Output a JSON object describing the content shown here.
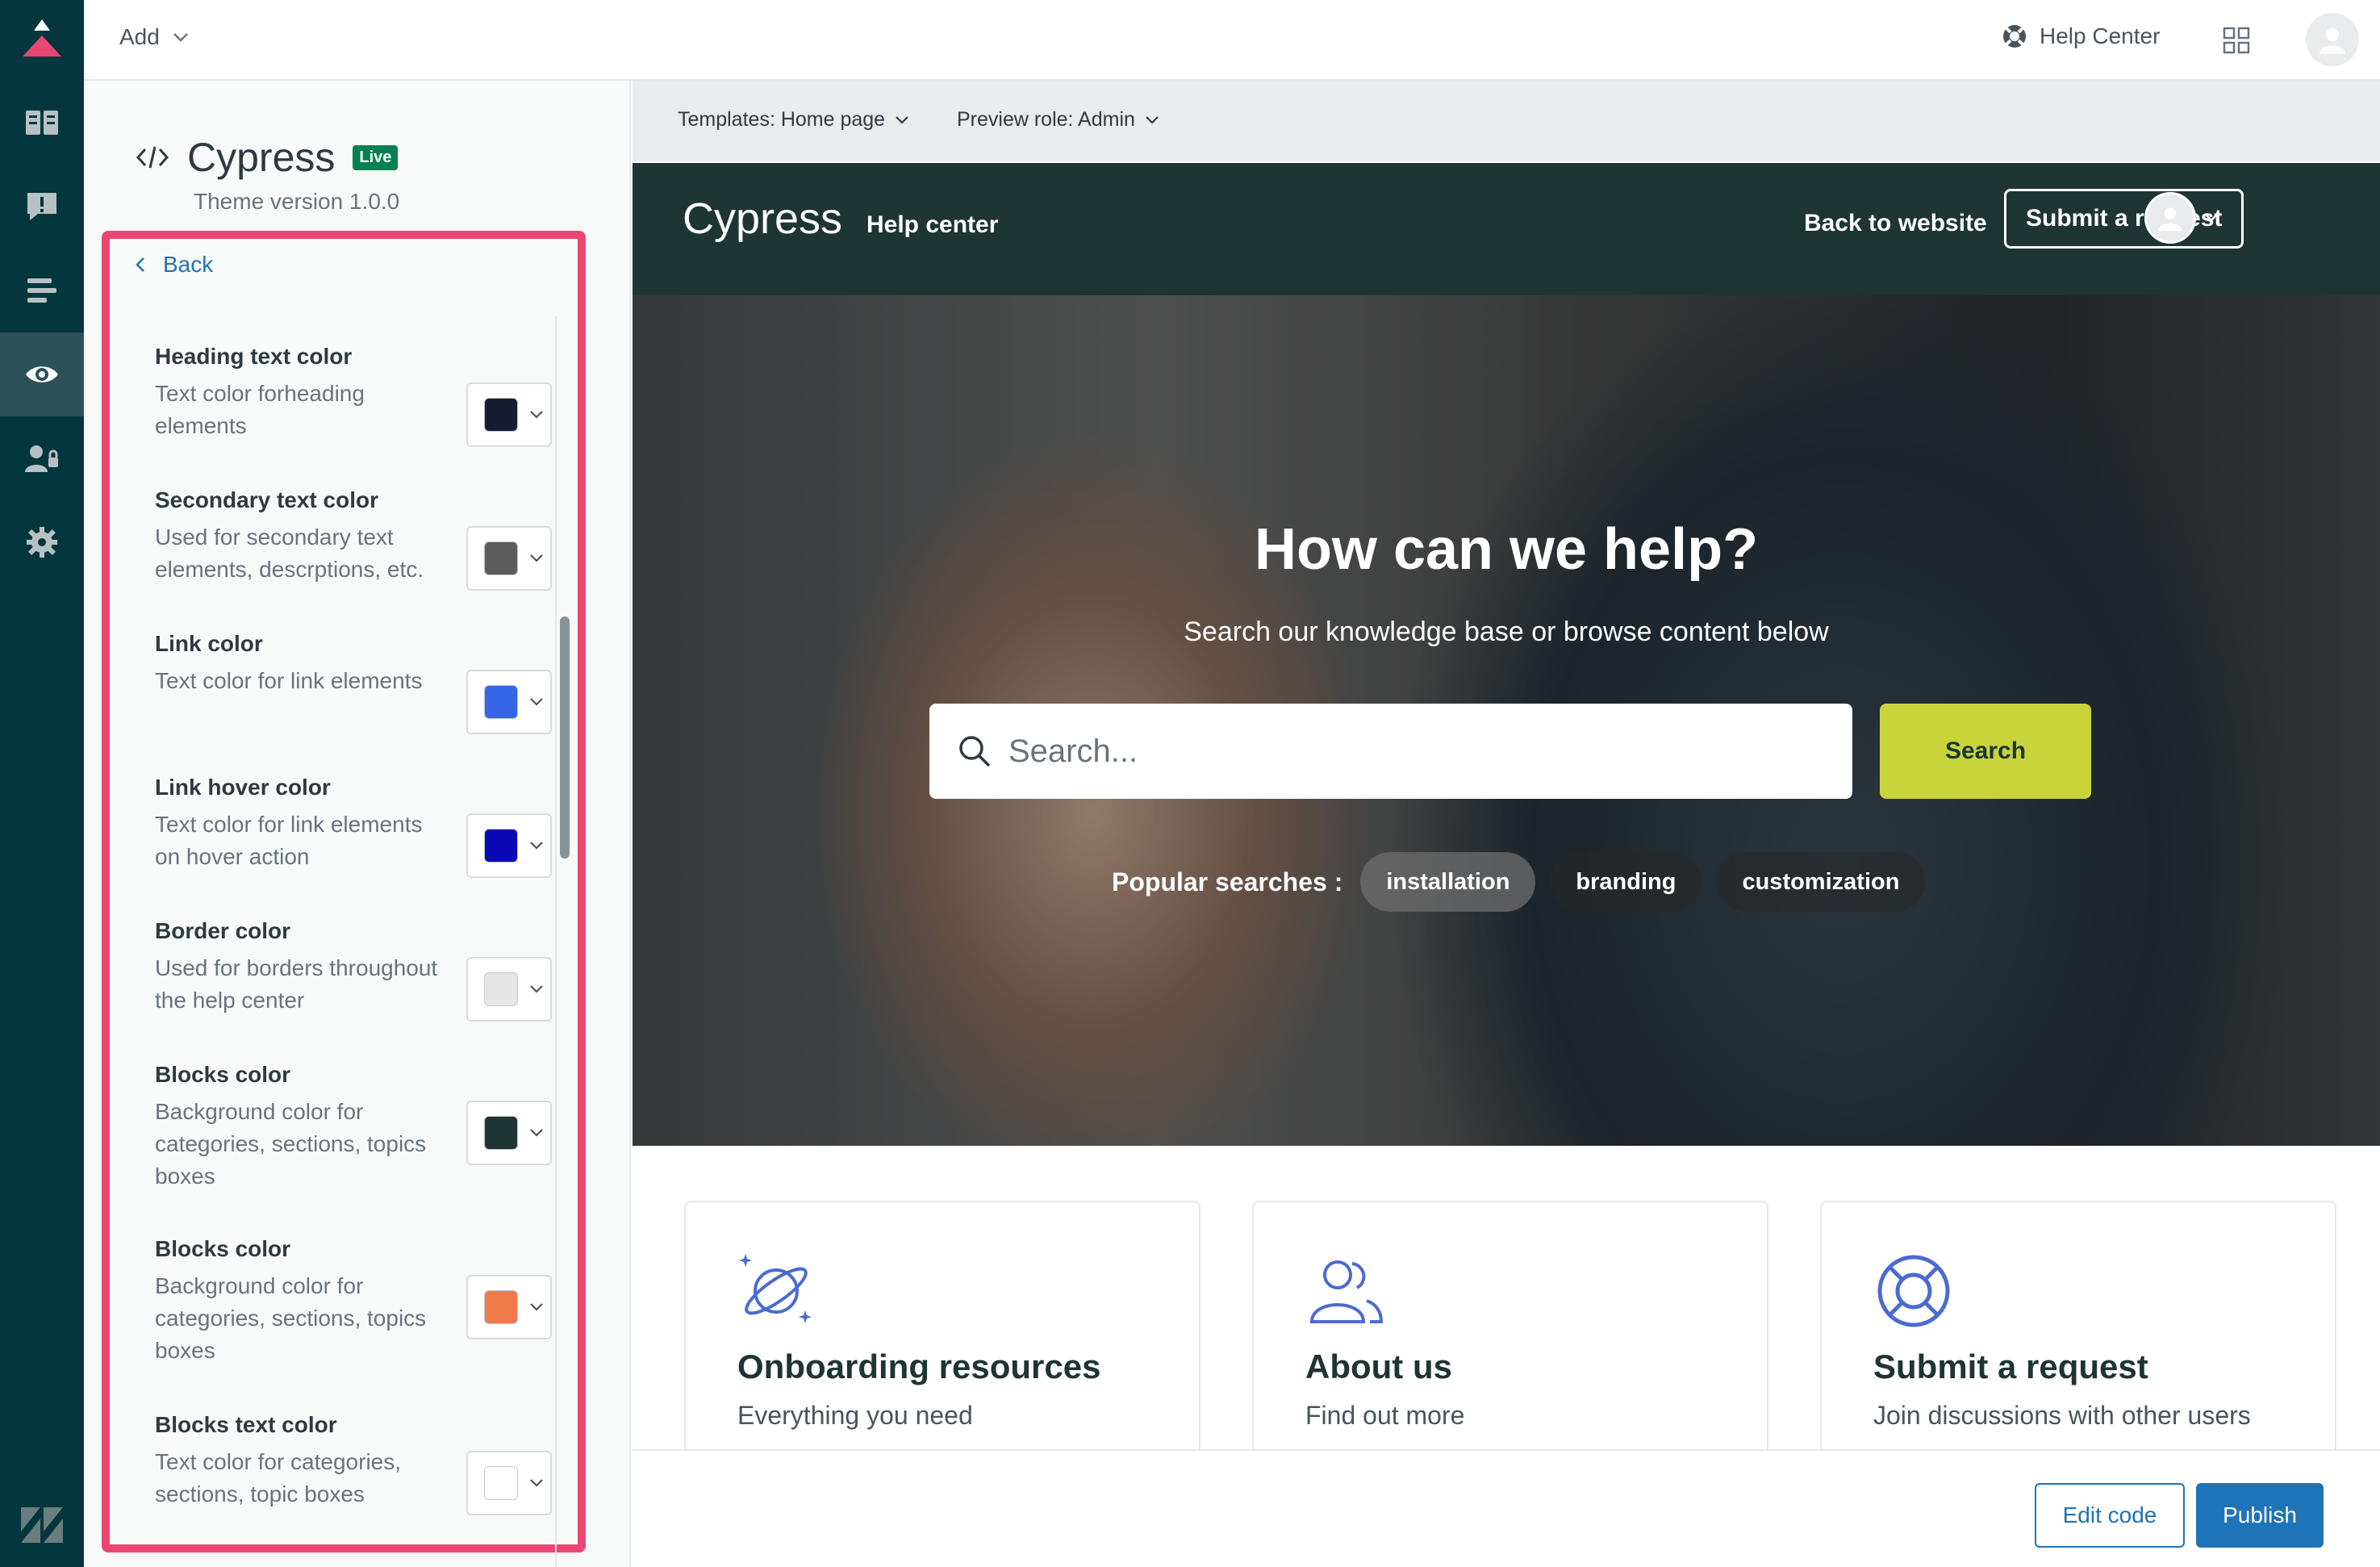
{
  "topbar": {
    "add_label": "Add",
    "help_center_label": "Help Center"
  },
  "rail": {
    "icons": [
      "zendesk-up-icon",
      "knowledge-icon",
      "alert-icon",
      "layout-icon",
      "eye-icon",
      "user-lock-icon",
      "gear-icon",
      "zendesk-logo-icon"
    ]
  },
  "panel": {
    "theme_name": "Cypress",
    "live_badge": "Live",
    "theme_version": "Theme version 1.0.0",
    "back_label": "Back",
    "settings": [
      {
        "title": "Heading text color",
        "description": "Text color forheading elements",
        "color": "#171c33"
      },
      {
        "title": "Secondary text color",
        "description": "Used for secondary text elements, descrptions, etc.",
        "color": "#5c5c5c"
      },
      {
        "title": "Link color",
        "description": "Text color for link elements",
        "color": "#3566e8"
      },
      {
        "title": "Link hover color",
        "description": "Text color for link elements on hover action",
        "color": "#0a0ab5"
      },
      {
        "title": "Border color",
        "description": "Used for borders throughout the help center",
        "color": "#e6e6e6"
      },
      {
        "title": "Blocks color",
        "description": "Background color for categories, sections, topics boxes",
        "color": "#1e3534"
      },
      {
        "title": "Blocks color",
        "description": "Background color for categories, sections, topics boxes",
        "color": "#ef7a4a"
      },
      {
        "title": "Blocks text color",
        "description": "Text color for categories, sections, topic boxes",
        "color": "#ffffff"
      }
    ],
    "highlight_color": "#eb4672"
  },
  "preview": {
    "template_select": "Templates: Home page",
    "role_select": "Preview role: Admin",
    "site_brand": "Cypress",
    "site_sub": "Help center",
    "back_to_website": "Back to website",
    "submit_request": "Submit a request",
    "hero_title": "How can we help?",
    "hero_tagline": "Search our knowledge base or browse content below",
    "search_placeholder": "Search...",
    "search_button": "Search",
    "popular_label": "Popular searches :",
    "popular_chips": [
      "installation",
      "branding",
      "customization"
    ],
    "cards": [
      {
        "title": "Onboarding resources",
        "subtitle": "Everything you need",
        "icon": "planet-icon"
      },
      {
        "title": "About us",
        "subtitle": "Find out more",
        "icon": "users-icon"
      },
      {
        "title": "Submit a request",
        "subtitle": "Join discussions with other users",
        "icon": "lifebuoy-icon"
      }
    ],
    "edit_code": "Edit code",
    "publish": "Publish"
  },
  "colors": {
    "rail_bg": "#03363d",
    "site_header_bg": "#1e3534",
    "search_button_bg": "#c9d43b",
    "accent_blue": "#1f73b7"
  }
}
